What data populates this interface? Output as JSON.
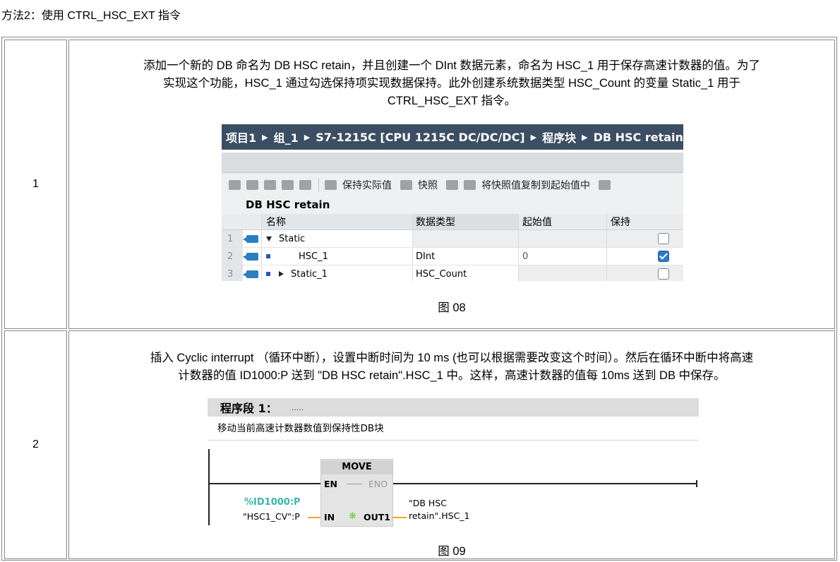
{
  "heading": "方法2：使用 CTRL_HSC_EXT 指令",
  "rows": [
    {
      "num": "1",
      "desc_lines": [
        "添加一个新的 DB 命名为 DB HSC retain，并且创建一个 DInt 数据元素，命名为 HSC_1 用于保存高速计数器的值。为了",
        "实现这个功能，HSC_1 通过勾选保持项实现数据保持。此外创建系统数据类型 HSC_Count 的变量 Static_1 用于",
        "CTRL_HSC_EXT 指令。"
      ],
      "caption": "图 08"
    },
    {
      "num": "2",
      "desc_lines": [
        "插入 Cyclic interrupt （循环中断），设置中断时间为 10 ms (也可以根据需要改变这个时间）。然后在循环中断中将高速",
        "计数器的值 ID1000:P 送到 \"DB HSC retain\".HSC_1 中。这样，高速计数器的值每 10ms 送到 DB 中保存。"
      ],
      "caption": "图 09"
    }
  ],
  "fig08": {
    "breadcrumb": [
      "项目1",
      "组_1",
      "S7-1215C [CPU 1215C DC/DC/DC]",
      "程序块",
      "DB HSC retain"
    ],
    "toolbar": {
      "keep_actual": "保持实际值",
      "snapshot": "快照",
      "copy_snapshot": "将快照值复制到起始值中"
    },
    "db_title": "DB HSC retain",
    "columns": {
      "name": "名称",
      "type": "数据类型",
      "init": "起始值",
      "retain": "保持"
    },
    "table": [
      {
        "idx": "1",
        "name": "Static",
        "type": "",
        "init": "",
        "retain": false
      },
      {
        "idx": "2",
        "name": "HSC_1",
        "type": "DInt",
        "init": "0",
        "retain": true
      },
      {
        "idx": "3",
        "name": "Static_1",
        "type": "HSC_Count",
        "init": "",
        "retain": false
      }
    ]
  },
  "fig09": {
    "network_title": "程序段 1：",
    "network_dots": ".....",
    "comment": "移动当前高速计数器数值到保持性DB块",
    "block_name": "MOVE",
    "pins": {
      "en": "EN",
      "eno": "ENO",
      "in": "IN",
      "out": "OUT1"
    },
    "in_address": "%ID1000:P",
    "in_symbol": "\"HSC1_CV\":P",
    "out_line1": "\"DB HSC",
    "out_line2": "retain\".HSC_1"
  },
  "colors": {
    "breadcrumb_bg": "#3b4e63",
    "checkbox_on": "#2c79c7",
    "address_teal": "#39b5ad",
    "wire_orange": "#f0a030"
  }
}
